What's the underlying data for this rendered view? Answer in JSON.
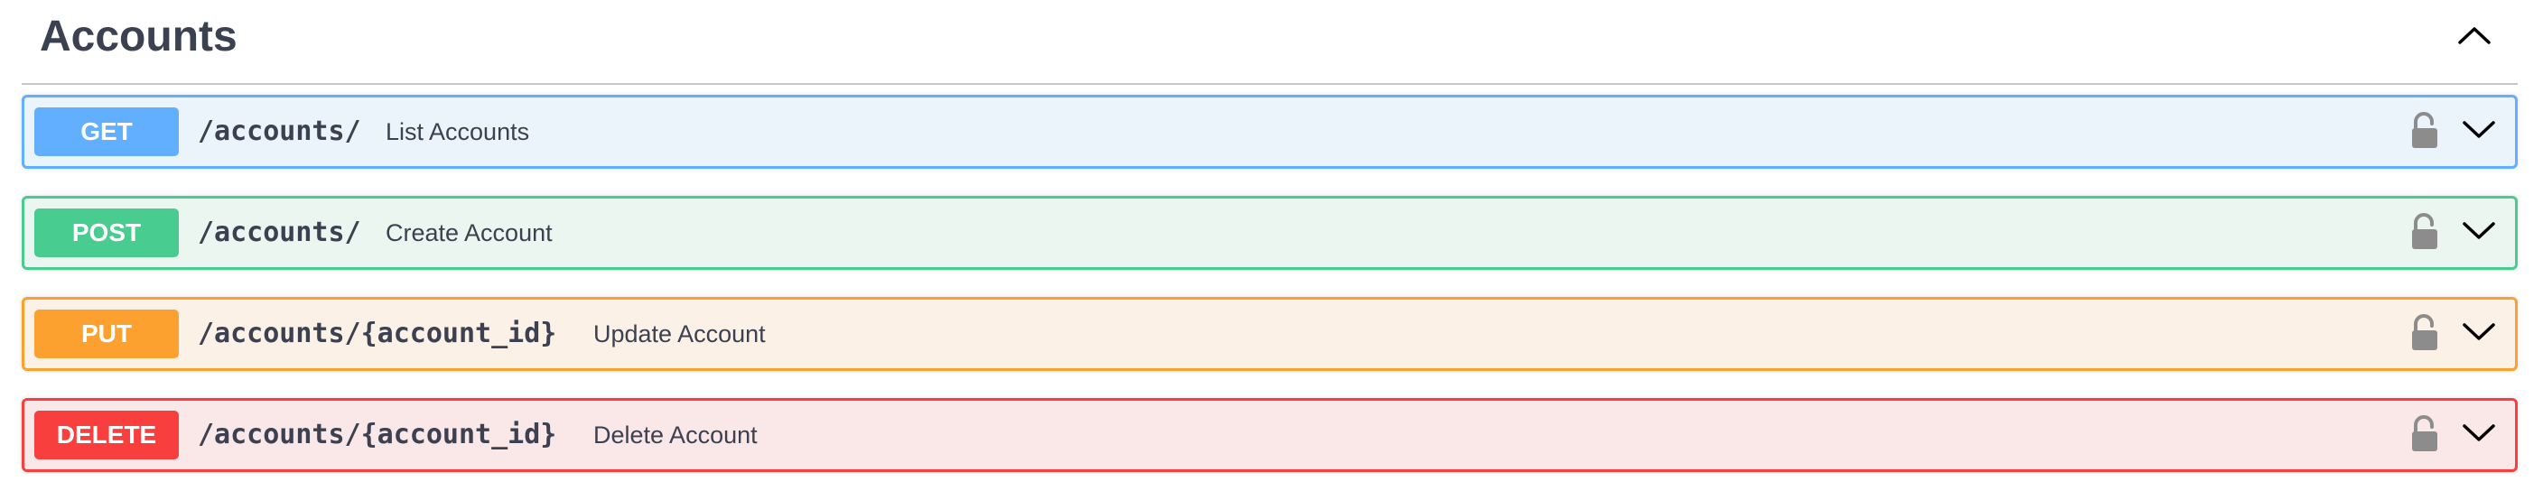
{
  "section": {
    "title": "Accounts",
    "collapse_icon": "chevron-up-icon"
  },
  "operations": [
    {
      "method": "GET",
      "path": "/accounts/",
      "summary": "List Accounts",
      "color": "#61affe",
      "background": "#ebf3fb",
      "lock_icon": "lock-icon",
      "expand_icon": "chevron-down-icon"
    },
    {
      "method": "POST",
      "path": "/accounts/",
      "summary": "Create Account",
      "color": "#49cc90",
      "background": "#ecf6f0",
      "lock_icon": "lock-icon",
      "expand_icon": "chevron-down-icon"
    },
    {
      "method": "PUT",
      "path": "/accounts/{account_id}",
      "summary": "Update Account",
      "color": "#fca130",
      "background": "#fbf1e6",
      "lock_icon": "lock-icon",
      "expand_icon": "chevron-down-icon"
    },
    {
      "method": "DELETE",
      "path": "/accounts/{account_id}",
      "summary": "Delete Account",
      "color": "#f93e3e",
      "background": "#fae7e7",
      "lock_icon": "lock-icon",
      "expand_icon": "chevron-down-icon"
    }
  ]
}
